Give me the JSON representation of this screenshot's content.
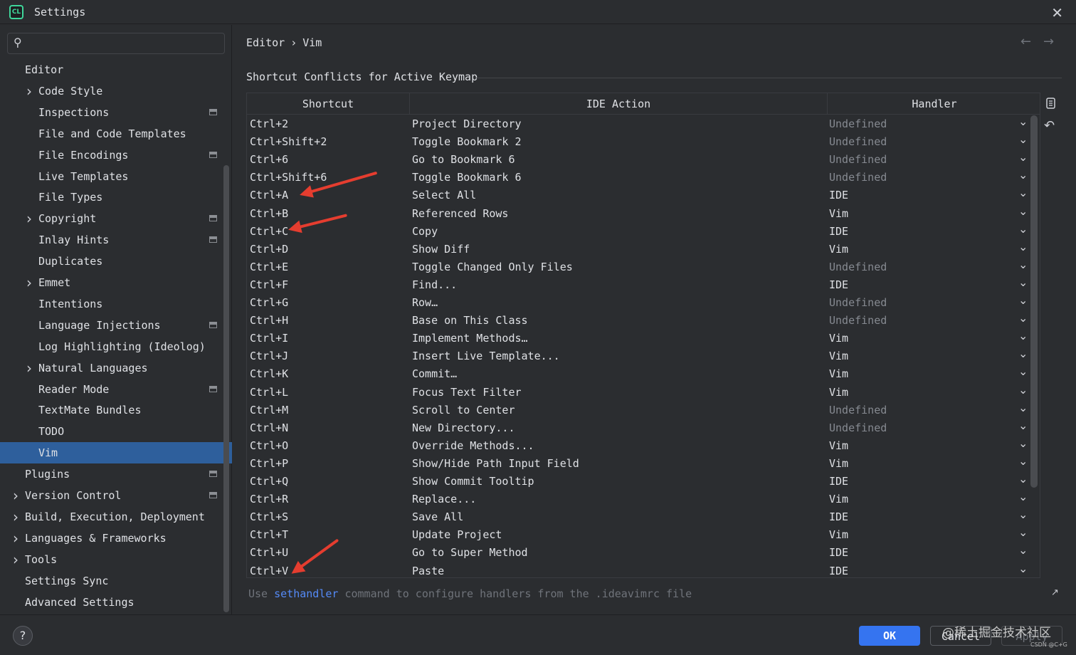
{
  "window": {
    "title": "Settings"
  },
  "search": {
    "placeholder": ""
  },
  "sidebar": {
    "items": [
      {
        "label": "Editor",
        "level": 0,
        "chevron": false,
        "badge": false,
        "selected": false
      },
      {
        "label": "Code Style",
        "level": 1,
        "chevron": true,
        "badge": false,
        "selected": false
      },
      {
        "label": "Inspections",
        "level": 1,
        "chevron": false,
        "badge": true,
        "selected": false
      },
      {
        "label": "File and Code Templates",
        "level": 1,
        "chevron": false,
        "badge": false,
        "selected": false
      },
      {
        "label": "File Encodings",
        "level": 1,
        "chevron": false,
        "badge": true,
        "selected": false
      },
      {
        "label": "Live Templates",
        "level": 1,
        "chevron": false,
        "badge": false,
        "selected": false
      },
      {
        "label": "File Types",
        "level": 1,
        "chevron": false,
        "badge": false,
        "selected": false
      },
      {
        "label": "Copyright",
        "level": 1,
        "chevron": true,
        "badge": true,
        "selected": false
      },
      {
        "label": "Inlay Hints",
        "level": 1,
        "chevron": false,
        "badge": true,
        "selected": false
      },
      {
        "label": "Duplicates",
        "level": 1,
        "chevron": false,
        "badge": false,
        "selected": false
      },
      {
        "label": "Emmet",
        "level": 1,
        "chevron": true,
        "badge": false,
        "selected": false
      },
      {
        "label": "Intentions",
        "level": 1,
        "chevron": false,
        "badge": false,
        "selected": false
      },
      {
        "label": "Language Injections",
        "level": 1,
        "chevron": false,
        "badge": true,
        "selected": false
      },
      {
        "label": "Log Highlighting (Ideolog)",
        "level": 1,
        "chevron": false,
        "badge": false,
        "selected": false
      },
      {
        "label": "Natural Languages",
        "level": 1,
        "chevron": true,
        "badge": false,
        "selected": false
      },
      {
        "label": "Reader Mode",
        "level": 1,
        "chevron": false,
        "badge": true,
        "selected": false
      },
      {
        "label": "TextMate Bundles",
        "level": 1,
        "chevron": false,
        "badge": false,
        "selected": false
      },
      {
        "label": "TODO",
        "level": 1,
        "chevron": false,
        "badge": false,
        "selected": false
      },
      {
        "label": "Vim",
        "level": 1,
        "chevron": false,
        "badge": false,
        "selected": true
      },
      {
        "label": "Plugins",
        "level": 0,
        "chevron": false,
        "badge": true,
        "selected": false
      },
      {
        "label": "Version Control",
        "level": 0,
        "chevron": true,
        "badge": true,
        "selected": false
      },
      {
        "label": "Build, Execution, Deployment",
        "level": 0,
        "chevron": true,
        "badge": false,
        "selected": false
      },
      {
        "label": "Languages & Frameworks",
        "level": 0,
        "chevron": true,
        "badge": false,
        "selected": false
      },
      {
        "label": "Tools",
        "level": 0,
        "chevron": true,
        "badge": false,
        "selected": false
      },
      {
        "label": "Settings Sync",
        "level": 0,
        "chevron": false,
        "badge": false,
        "selected": false
      },
      {
        "label": "Advanced Settings",
        "level": 0,
        "chevron": false,
        "badge": false,
        "selected": false
      }
    ]
  },
  "breadcrumb": {
    "parent": "Editor",
    "separator": "›",
    "current": "Vim"
  },
  "section": {
    "title": "Shortcut Conflicts for Active Keymap"
  },
  "table": {
    "columns": [
      "Shortcut",
      "IDE Action",
      "Handler"
    ],
    "rows": [
      {
        "shortcut": "Ctrl+2",
        "action": "Project Directory",
        "handler": "Undefined"
      },
      {
        "shortcut": "Ctrl+Shift+2",
        "action": "Toggle Bookmark 2",
        "handler": "Undefined"
      },
      {
        "shortcut": "Ctrl+6",
        "action": "Go to Bookmark 6",
        "handler": "Undefined"
      },
      {
        "shortcut": "Ctrl+Shift+6",
        "action": "Toggle Bookmark 6",
        "handler": "Undefined"
      },
      {
        "shortcut": "Ctrl+A",
        "action": "Select All",
        "handler": "IDE"
      },
      {
        "shortcut": "Ctrl+B",
        "action": "Referenced Rows",
        "handler": "Vim"
      },
      {
        "shortcut": "Ctrl+C",
        "action": "Copy",
        "handler": "IDE"
      },
      {
        "shortcut": "Ctrl+D",
        "action": "Show Diff",
        "handler": "Vim"
      },
      {
        "shortcut": "Ctrl+E",
        "action": "Toggle Changed Only Files",
        "handler": "Undefined"
      },
      {
        "shortcut": "Ctrl+F",
        "action": "Find...",
        "handler": "IDE"
      },
      {
        "shortcut": "Ctrl+G",
        "action": "Row…",
        "handler": "Undefined"
      },
      {
        "shortcut": "Ctrl+H",
        "action": "Base on This Class",
        "handler": "Undefined"
      },
      {
        "shortcut": "Ctrl+I",
        "action": "Implement Methods…",
        "handler": "Vim"
      },
      {
        "shortcut": "Ctrl+J",
        "action": "Insert Live Template...",
        "handler": "Vim"
      },
      {
        "shortcut": "Ctrl+K",
        "action": "Commit…",
        "handler": "Vim"
      },
      {
        "shortcut": "Ctrl+L",
        "action": "Focus Text Filter",
        "handler": "Vim"
      },
      {
        "shortcut": "Ctrl+M",
        "action": "Scroll to Center",
        "handler": "Undefined"
      },
      {
        "shortcut": "Ctrl+N",
        "action": "New Directory...",
        "handler": "Undefined"
      },
      {
        "shortcut": "Ctrl+O",
        "action": "Override Methods...",
        "handler": "Vim"
      },
      {
        "shortcut": "Ctrl+P",
        "action": "Show/Hide Path Input Field",
        "handler": "Vim"
      },
      {
        "shortcut": "Ctrl+Q",
        "action": "Show Commit Tooltip",
        "handler": "IDE"
      },
      {
        "shortcut": "Ctrl+R",
        "action": "Replace...",
        "handler": "Vim"
      },
      {
        "shortcut": "Ctrl+S",
        "action": "Save All",
        "handler": "IDE"
      },
      {
        "shortcut": "Ctrl+T",
        "action": "Update Project",
        "handler": "Vim"
      },
      {
        "shortcut": "Ctrl+U",
        "action": "Go to Super Method",
        "handler": "IDE"
      },
      {
        "shortcut": "Ctrl+V",
        "action": "Paste",
        "handler": "IDE"
      }
    ]
  },
  "hint": {
    "prefix": "Use ",
    "link": "sethandler",
    "suffix": " command to configure handlers from the .ideavimrc file"
  },
  "footer": {
    "help_label": "?",
    "ok_label": "OK",
    "cancel_label": "Cancel",
    "apply_label": "Apply",
    "watermark": "@稀土掘金技术社区",
    "watermark_small": "CSDN @C+G"
  },
  "colors": {
    "background": "#2b2d30",
    "selection": "#2e5f9c",
    "accent": "#3574f0",
    "link": "#548af7",
    "annotation_arrow": "#e53d2f",
    "muted_text": "#868a91"
  },
  "icons": {
    "app": "intellij-clion-icon",
    "close": "close-icon",
    "search": "search-icon",
    "back": "arrow-left-icon",
    "forward": "arrow-right-icon",
    "copy": "copy-icon",
    "reset": "reset-icon",
    "expand": "expand-icon"
  }
}
